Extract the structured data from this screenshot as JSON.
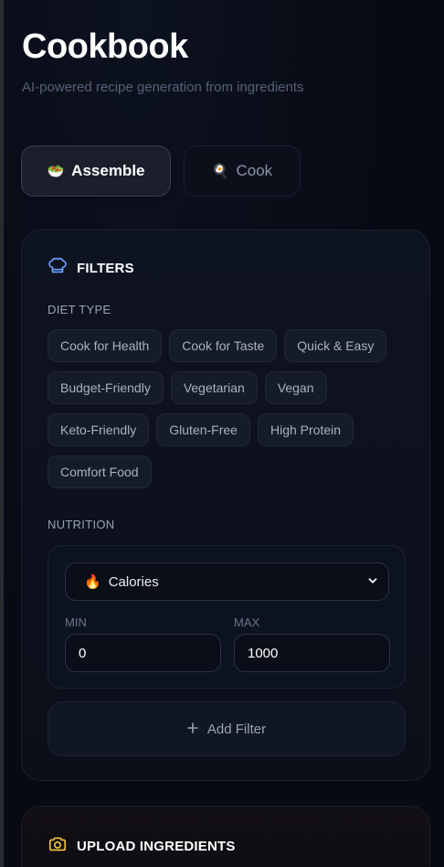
{
  "header": {
    "title": "Cookbook",
    "subtitle": "AI-powered recipe generation from ingredients"
  },
  "tabs": [
    {
      "label": "Assemble",
      "icon": "salad-bowl-icon",
      "glyph": "🥗",
      "active": true
    },
    {
      "label": "Cook",
      "icon": "frying-pan-icon",
      "glyph": "🍳",
      "active": false
    }
  ],
  "filters": {
    "title": "FILTERS",
    "icon": "chef-hat-icon",
    "diet_label": "DIET TYPE",
    "diet_options": [
      "Cook for Health",
      "Cook for Taste",
      "Quick & Easy",
      "Budget-Friendly",
      "Vegetarian",
      "Vegan",
      "Keto-Friendly",
      "Gluten-Free",
      "High Protein",
      "Comfort Food"
    ],
    "nutrition_label": "NUTRITION",
    "nutrition": {
      "selected": "Calories",
      "selected_icon": "🔥",
      "min_label": "MIN",
      "min_value": "0",
      "max_label": "MAX",
      "max_value": "1000"
    },
    "add_filter_label": "Add Filter"
  },
  "upload": {
    "title": "UPLOAD INGREDIENTS",
    "icon": "camera-icon"
  },
  "colors": {
    "background": "#070a13",
    "accent_blue": "#6aa2ff",
    "accent_yellow": "#f5c542"
  }
}
